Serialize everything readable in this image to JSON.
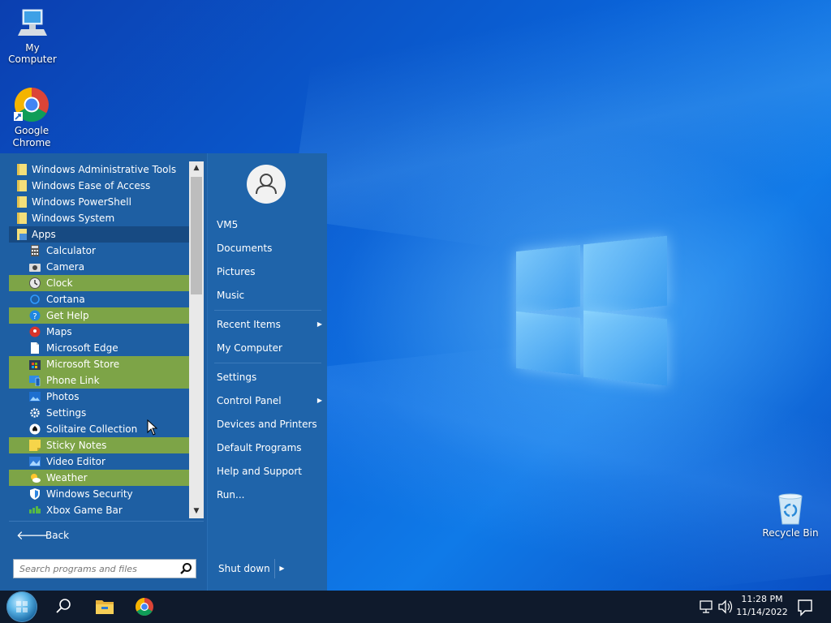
{
  "desktop": {
    "icons": [
      {
        "label": "My Computer"
      },
      {
        "label": "Google Chrome"
      },
      {
        "label": "Recycle Bin"
      }
    ]
  },
  "start_menu": {
    "programs": [
      {
        "label": "Windows Administrative Tools",
        "kind": "folder",
        "icon": "folder-icon"
      },
      {
        "label": "Windows Ease of Access",
        "kind": "folder",
        "icon": "folder-icon"
      },
      {
        "label": "Windows PowerShell",
        "kind": "folder",
        "icon": "folder-icon"
      },
      {
        "label": "Windows System",
        "kind": "folder",
        "icon": "folder-icon"
      },
      {
        "label": "Apps",
        "kind": "expanded",
        "icon": "apps-folder-icon"
      },
      {
        "label": "Calculator",
        "kind": "app",
        "icon": "calculator-icon"
      },
      {
        "label": "Camera",
        "kind": "app",
        "icon": "camera-icon"
      },
      {
        "label": "Clock",
        "kind": "app",
        "icon": "clock-icon",
        "highlight": true
      },
      {
        "label": "Cortana",
        "kind": "app",
        "icon": "cortana-icon"
      },
      {
        "label": "Get Help",
        "kind": "app",
        "icon": "help-icon",
        "highlight": true
      },
      {
        "label": "Maps",
        "kind": "app",
        "icon": "maps-icon"
      },
      {
        "label": "Microsoft Edge",
        "kind": "app",
        "icon": "document-icon"
      },
      {
        "label": "Microsoft Store",
        "kind": "app",
        "icon": "store-icon",
        "highlight": true
      },
      {
        "label": "Phone Link",
        "kind": "app",
        "icon": "phone-link-icon",
        "highlight": true
      },
      {
        "label": "Photos",
        "kind": "app",
        "icon": "photos-icon"
      },
      {
        "label": "Settings",
        "kind": "app",
        "icon": "gear-icon"
      },
      {
        "label": "Solitaire Collection",
        "kind": "app",
        "icon": "solitaire-icon"
      },
      {
        "label": "Sticky Notes",
        "kind": "app",
        "icon": "sticky-notes-icon",
        "highlight": true
      },
      {
        "label": "Video Editor",
        "kind": "app",
        "icon": "video-editor-icon"
      },
      {
        "label": "Weather",
        "kind": "app",
        "icon": "weather-icon",
        "highlight": true
      },
      {
        "label": "Windows Security",
        "kind": "app",
        "icon": "shield-icon"
      },
      {
        "label": "Xbox Game Bar",
        "kind": "app",
        "icon": "xbox-icon"
      }
    ],
    "back_label": "Back",
    "search_placeholder": "Search programs and files",
    "right_items": {
      "user": "VM5",
      "documents": "Documents",
      "pictures": "Pictures",
      "music": "Music",
      "recent_items": "Recent Items",
      "my_computer": "My Computer",
      "settings": "Settings",
      "control_panel": "Control Panel",
      "devices_printers": "Devices and Printers",
      "default_programs": "Default Programs",
      "help_support": "Help and Support",
      "run": "Run..."
    },
    "shutdown_label": "Shut down"
  },
  "taskbar": {
    "time": "11:28 PM",
    "date": "11/14/2022"
  },
  "colors": {
    "menu_bg": "#1e5fa3",
    "highlight": "#7da447",
    "taskbar": "#0f1a2c"
  }
}
